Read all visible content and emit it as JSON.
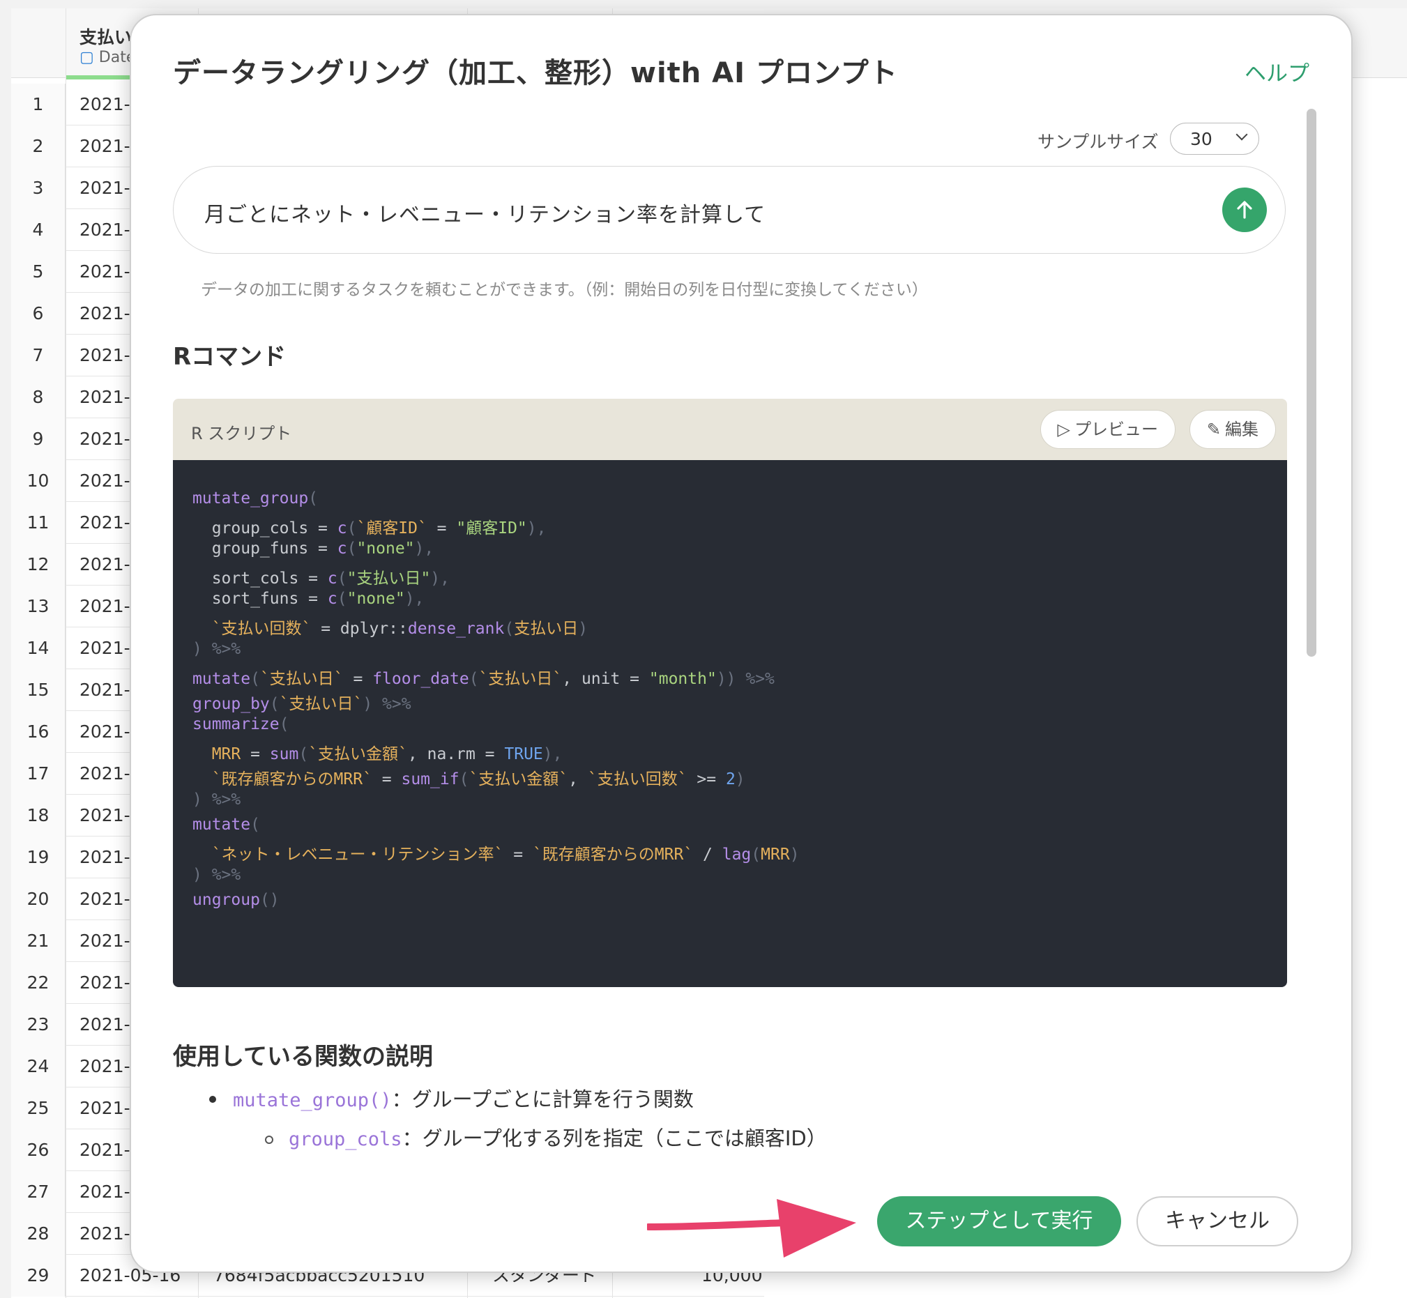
{
  "sheet": {
    "column_title": "支払い",
    "column_type": "Date",
    "rows": [
      {
        "n": "1",
        "v": "2021-"
      },
      {
        "n": "2",
        "v": "2021-"
      },
      {
        "n": "3",
        "v": "2021-"
      },
      {
        "n": "4",
        "v": "2021-"
      },
      {
        "n": "5",
        "v": "2021-"
      },
      {
        "n": "6",
        "v": "2021-"
      },
      {
        "n": "7",
        "v": "2021-"
      },
      {
        "n": "8",
        "v": "2021-"
      },
      {
        "n": "9",
        "v": "2021-"
      },
      {
        "n": "10",
        "v": "2021-"
      },
      {
        "n": "11",
        "v": "2021-"
      },
      {
        "n": "12",
        "v": "2021-"
      },
      {
        "n": "13",
        "v": "2021-"
      },
      {
        "n": "14",
        "v": "2021-"
      },
      {
        "n": "15",
        "v": "2021-"
      },
      {
        "n": "16",
        "v": "2021-"
      },
      {
        "n": "17",
        "v": "2021-"
      },
      {
        "n": "18",
        "v": "2021-"
      },
      {
        "n": "19",
        "v": "2021-"
      },
      {
        "n": "20",
        "v": "2021-"
      },
      {
        "n": "21",
        "v": "2021-"
      },
      {
        "n": "22",
        "v": "2021-"
      },
      {
        "n": "23",
        "v": "2021-"
      },
      {
        "n": "24",
        "v": "2021-"
      },
      {
        "n": "25",
        "v": "2021-"
      },
      {
        "n": "26",
        "v": "2021-"
      },
      {
        "n": "27",
        "v": "2021-"
      },
      {
        "n": "28",
        "v": "2021-"
      }
    ],
    "last_row": {
      "n": "29",
      "v": "2021-05-16",
      "c3": "7684f5acbbacc5201510",
      "c4": "スタンダード",
      "c5": "10,000"
    }
  },
  "modal": {
    "title": "データラングリング（加工、整形）with AI プロンプト",
    "help": "ヘルプ",
    "sample_size_label": "サンプルサイズ",
    "sample_size_value": "30",
    "prompt_text": "月ごとにネット・レベニュー・リテンション率を計算して",
    "prompt_hint": "データの加工に関するタスクを頼むことができます。（例：開始日の列を日付型に変換してください）",
    "r_command_heading": "Rコマンド",
    "script_label": "R スクリプト",
    "preview_button": "プレビュー",
    "edit_button": "編集",
    "code": {
      "l1_fn": "mutate_group",
      "l1_p": "(",
      "l2_a": "  group_cols = ",
      "l2_fn": "c",
      "l2_p1": "(",
      "l2_col": "`顧客ID`",
      "l2_eq": " = ",
      "l2_str": "\"顧客ID\"",
      "l2_p2": "),",
      "l3_a": "  group_funs = ",
      "l3_fn": "c",
      "l3_p1": "(",
      "l3_str": "\"none\"",
      "l3_p2": "),",
      "l4_a": "  sort_cols = ",
      "l4_fn": "c",
      "l4_p1": "(",
      "l4_str": "\"支払い日\"",
      "l4_p2": "),",
      "l5_a": "  sort_funs = ",
      "l5_fn": "c",
      "l5_p1": "(",
      "l5_str": "\"none\"",
      "l5_p2": "),",
      "l6_col": "  `支払い回数`",
      "l6_a": " = dplyr::",
      "l6_fn": "dense_rank",
      "l6_p1": "(",
      "l6_col2": "支払い日",
      "l6_p2": ")",
      "l7": ") %>%",
      "l8_fn": "mutate",
      "l8_p1": "(",
      "l8_col": "`支払い日`",
      "l8_a": " = ",
      "l8_fn2": "floor_date",
      "l8_p2": "(",
      "l8_col2": "`支払い日`",
      "l8_b": ", unit = ",
      "l8_str": "\"month\"",
      "l8_p3": ")) %>%",
      "l9_fn": "group_by",
      "l9_p1": "(",
      "l9_col": "`支払い日`",
      "l9_p2": ") %>%",
      "l10_fn": "summarize",
      "l10_p": "(",
      "l11_col": "  MRR",
      "l11_a": " = ",
      "l11_fn": "sum",
      "l11_p1": "(",
      "l11_col2": "`支払い金額`",
      "l11_b": ", na.rm = ",
      "l11_num": "TRUE",
      "l11_p2": "),",
      "l12_col": "  `既存顧客からのMRR`",
      "l12_a": " = ",
      "l12_fn": "sum_if",
      "l12_p1": "(",
      "l12_col2": "`支払い金額`",
      "l12_b": ", ",
      "l12_col3": "`支払い回数`",
      "l12_c": " >= ",
      "l12_num": "2",
      "l12_p2": ")",
      "l13": ") %>%",
      "l14_fn": "mutate",
      "l14_p": "(",
      "l15_col": "  `ネット・レベニュー・リテンション率`",
      "l15_a": " = ",
      "l15_col2": "`既存顧客からのMRR`",
      "l15_b": " / ",
      "l15_fn": "lag",
      "l15_p1": "(",
      "l15_col3": "MRR",
      "l15_p2": ")",
      "l16": ") %>%",
      "l17_fn": "ungroup",
      "l17_p": "()"
    },
    "functions_heading": "使用している関数の説明",
    "explanations": [
      {
        "code": "mutate_group()",
        "text": "：グループごとに計算を行う関数"
      },
      {
        "code": "group_cols",
        "text": "：グループ化する列を指定（ここでは顧客ID）"
      }
    ],
    "run_button": "ステップとして実行",
    "cancel_button": "キャンセル"
  },
  "colors": {
    "accent_green": "#3aa66d",
    "arrow_pink": "#e8416b",
    "code_bg": "#282c34"
  }
}
